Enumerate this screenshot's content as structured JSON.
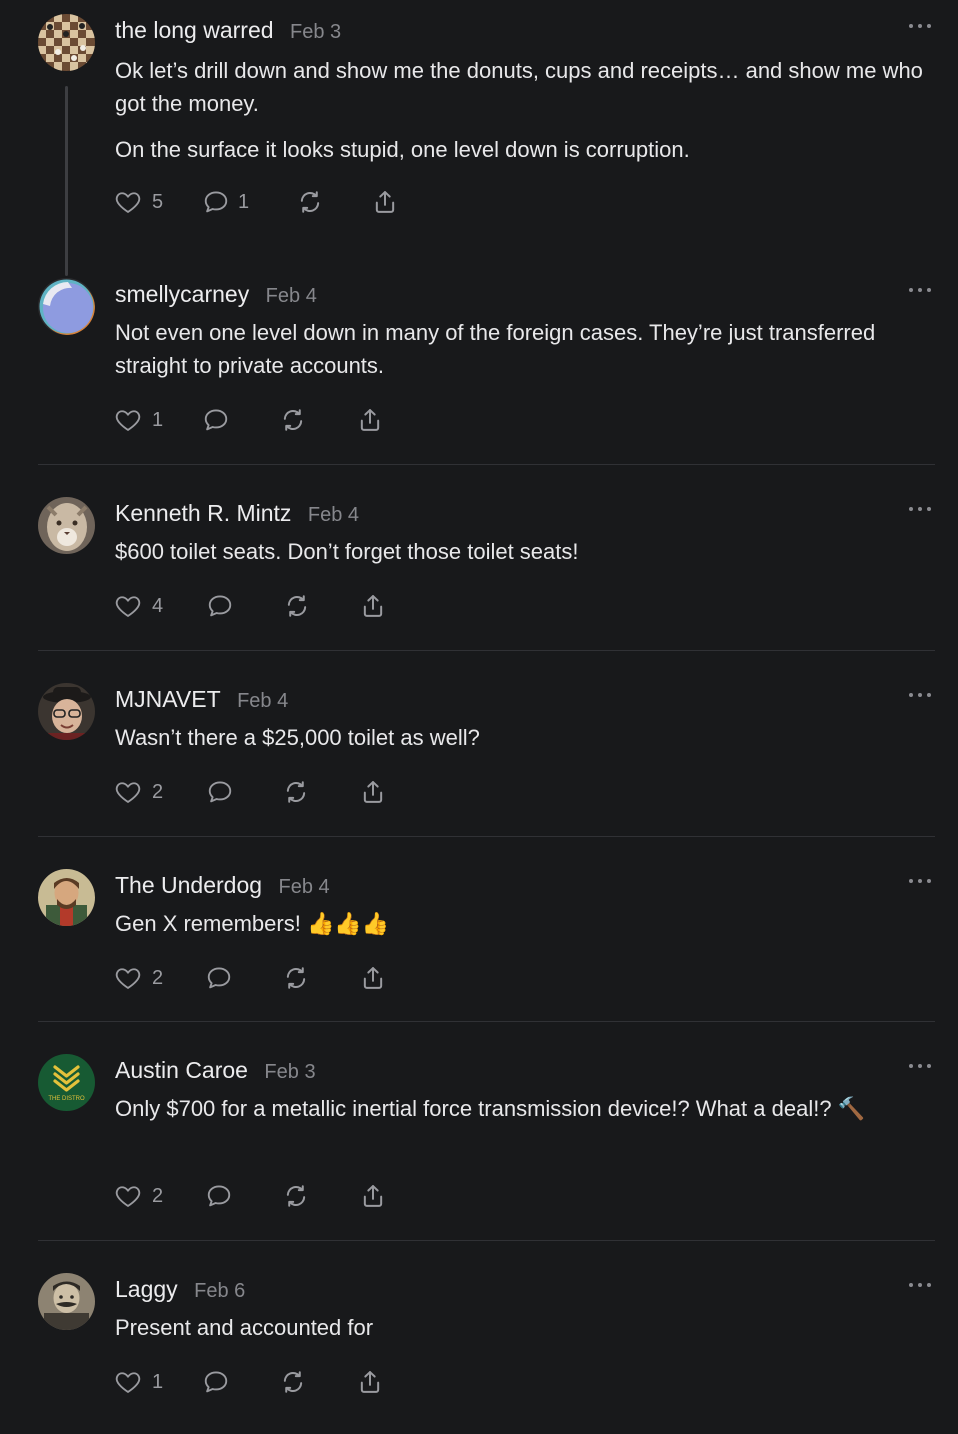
{
  "more_label": "More options",
  "comments": [
    {
      "author": "the long warred",
      "date": "Feb 3",
      "paragraphs": [
        "Ok let’s drill down and show me the donuts, cups and receipts… and show me who got the money.",
        "On the surface it looks stupid, one level down is corruption."
      ],
      "likes": "5",
      "replies": "1"
    },
    {
      "author": "smellycarney",
      "date": "Feb 4",
      "paragraphs": [
        "Not even one level down in many of the foreign cases. They’re just transferred straight to private accounts."
      ],
      "likes": "1",
      "replies": ""
    },
    {
      "author": "Kenneth R. Mintz",
      "date": "Feb 4",
      "paragraphs": [
        "$600 toilet seats. Don’t forget those toilet seats!"
      ],
      "likes": "4",
      "replies": ""
    },
    {
      "author": "MJNAVET",
      "date": "Feb 4",
      "paragraphs": [
        "Wasn’t there a $25,000 toilet as well?"
      ],
      "likes": "2",
      "replies": ""
    },
    {
      "author": "The Underdog",
      "date": "Feb 4",
      "paragraphs": [
        "Gen X remembers! 👍👍👍"
      ],
      "likes": "2",
      "replies": ""
    },
    {
      "author": "Austin Caroe",
      "date": "Feb 3",
      "avatar_text": "THE DISTRO",
      "paragraphs": [
        "Only $700 for a metallic inertial force transmission device!? What a deal!? 🔨"
      ],
      "likes": "2",
      "replies": ""
    },
    {
      "author": "Laggy",
      "date": "Feb 6",
      "paragraphs": [
        "Present and accounted for"
      ],
      "likes": "1",
      "replies": ""
    }
  ]
}
